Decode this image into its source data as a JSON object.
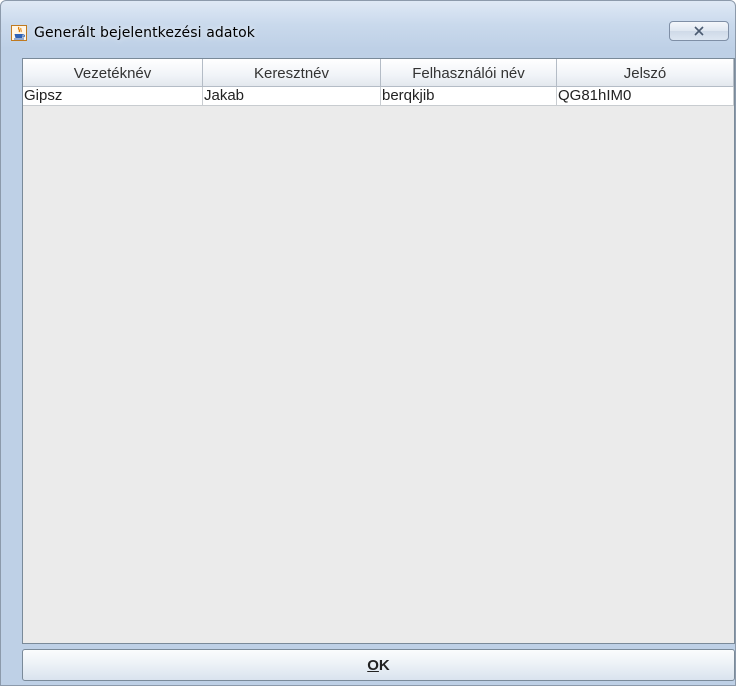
{
  "window": {
    "title": "Generált bejelentkezési adatok",
    "icon": "java-cup-icon",
    "close_icon": "close-icon"
  },
  "table": {
    "columns": [
      "Vezetéknév",
      "Keresztnév",
      "Felhasználói név",
      "Jelszó"
    ],
    "rows": [
      [
        "Gipsz",
        "Jakab",
        "berqkjib",
        "QG81hIM0"
      ]
    ]
  },
  "ok_button": {
    "mnemonic": "O",
    "rest": "K"
  },
  "colors": {
    "frame": "#bed0e6",
    "table_background": "#ebebeb",
    "java_icon_orange": "#e07b00"
  }
}
